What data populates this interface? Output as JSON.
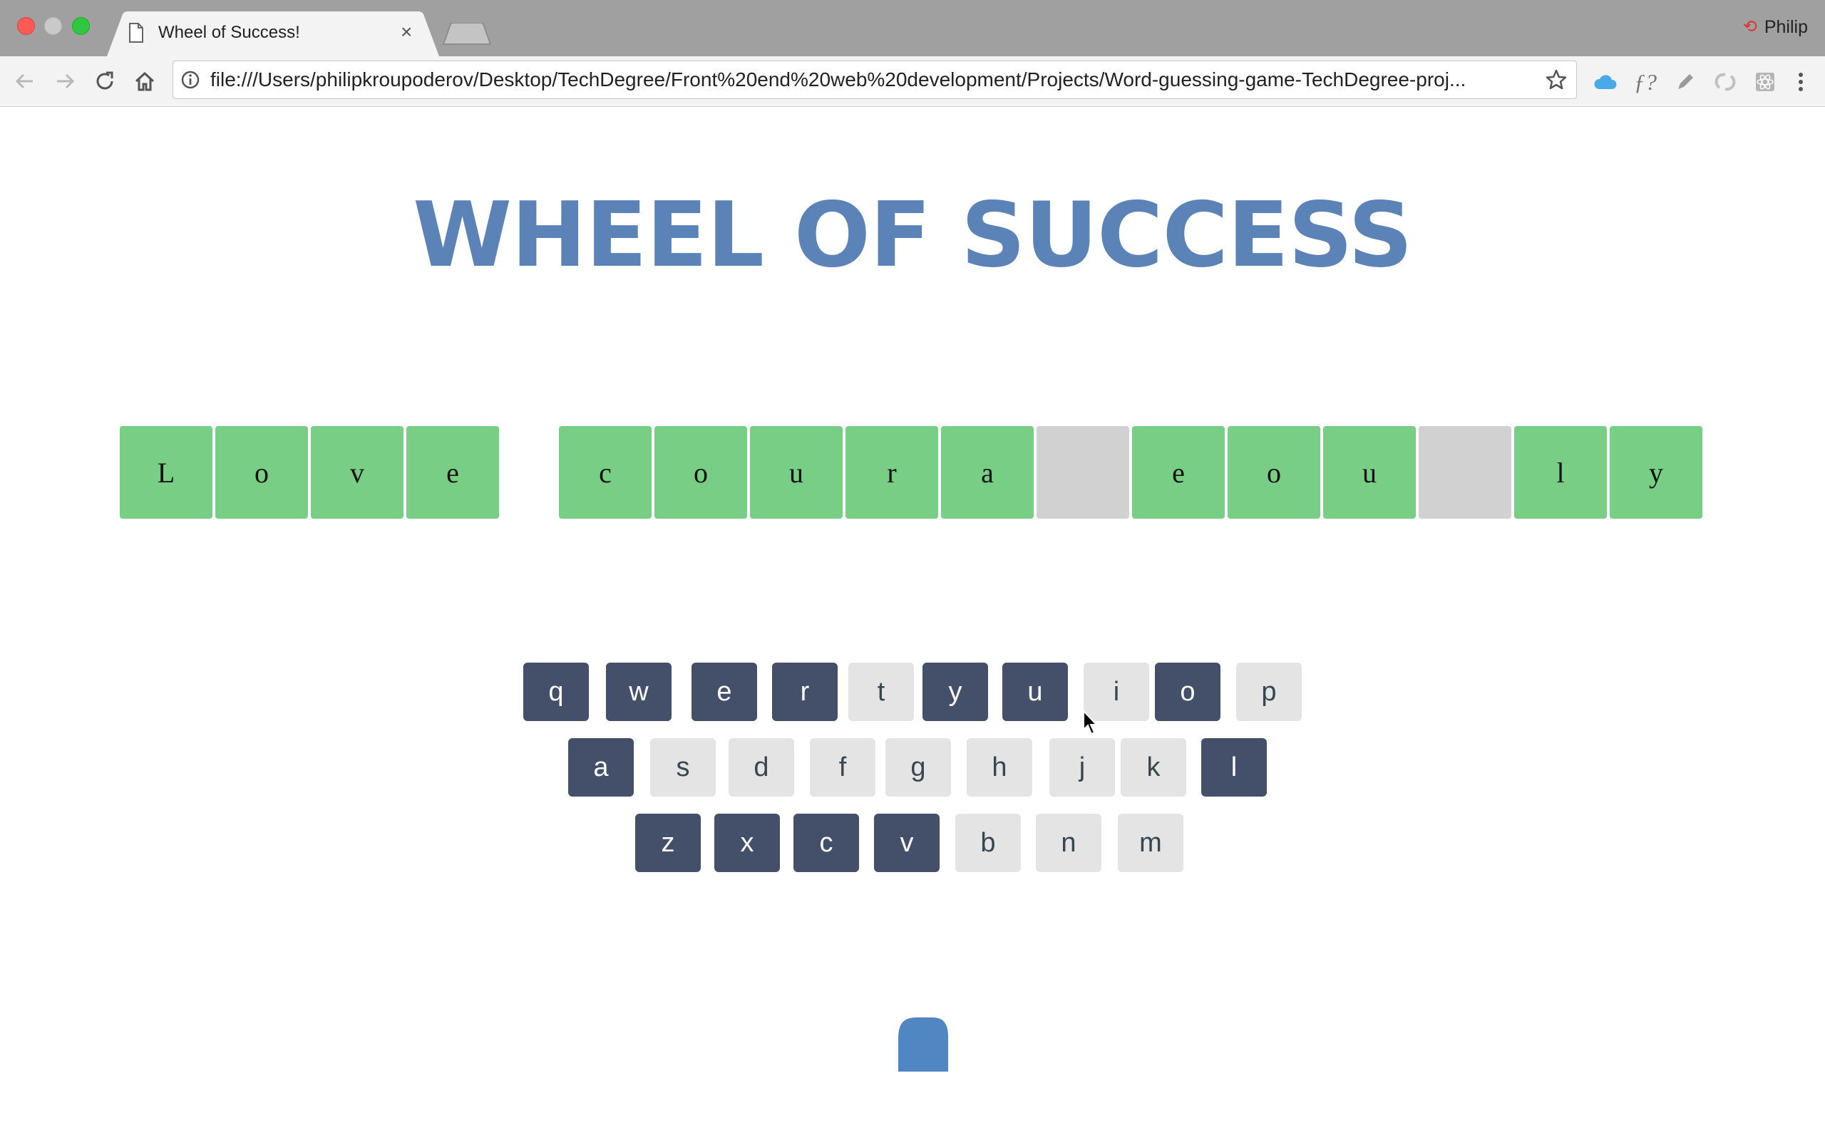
{
  "browser": {
    "tab_title": "Wheel of Success!",
    "tab_close": "×",
    "url": "file:///Users/philipkroupoderov/Desktop/TechDegree/Front%20end%20web%20development/Projects/Word-guessing-game-TechDegree-proj...",
    "profile_name": "Philip",
    "icons": [
      "back-icon",
      "forward-icon",
      "reload-icon",
      "home-icon",
      "info-icon",
      "star-icon",
      "cloud-extension-icon",
      "font-extension-icon",
      "pen-extension-icon",
      "sync-extension-icon",
      "react-extension-icon",
      "menu-icon"
    ]
  },
  "game": {
    "title": "WHEEL OF SUCCESS",
    "phrase": [
      {
        "letter": "L",
        "shown": true
      },
      {
        "letter": "o",
        "shown": true
      },
      {
        "letter": "v",
        "shown": true
      },
      {
        "letter": "e",
        "shown": true
      },
      {
        "letter": "c",
        "shown": true
      },
      {
        "letter": "o",
        "shown": true
      },
      {
        "letter": "u",
        "shown": true
      },
      {
        "letter": "r",
        "shown": true
      },
      {
        "letter": "a",
        "shown": true
      },
      {
        "letter": "",
        "shown": false
      },
      {
        "letter": "e",
        "shown": true
      },
      {
        "letter": "o",
        "shown": true
      },
      {
        "letter": "u",
        "shown": true
      },
      {
        "letter": "",
        "shown": false
      },
      {
        "letter": "l",
        "shown": true
      },
      {
        "letter": "y",
        "shown": true
      }
    ],
    "keyboard": {
      "row1": [
        {
          "key": "q",
          "chosen": true
        },
        {
          "key": "w",
          "chosen": true
        },
        {
          "key": "e",
          "chosen": true
        },
        {
          "key": "r",
          "chosen": true
        },
        {
          "key": "t",
          "chosen": false
        },
        {
          "key": "y",
          "chosen": true
        },
        {
          "key": "u",
          "chosen": true
        },
        {
          "key": "i",
          "chosen": false
        },
        {
          "key": "o",
          "chosen": true
        },
        {
          "key": "p",
          "chosen": false
        }
      ],
      "row2": [
        {
          "key": "a",
          "chosen": true
        },
        {
          "key": "s",
          "chosen": false
        },
        {
          "key": "d",
          "chosen": false
        },
        {
          "key": "f",
          "chosen": false
        },
        {
          "key": "g",
          "chosen": false
        },
        {
          "key": "h",
          "chosen": false
        },
        {
          "key": "j",
          "chosen": false
        },
        {
          "key": "k",
          "chosen": false
        },
        {
          "key": "l",
          "chosen": true
        }
      ],
      "row3": [
        {
          "key": "z",
          "chosen": true
        },
        {
          "key": "x",
          "chosen": true
        },
        {
          "key": "c",
          "chosen": true
        },
        {
          "key": "v",
          "chosen": true
        },
        {
          "key": "b",
          "chosen": false
        },
        {
          "key": "n",
          "chosen": false
        },
        {
          "key": "m",
          "chosen": false
        }
      ]
    },
    "lives_shown": 1,
    "colors": {
      "title": "#5b83b7",
      "shown_tile": "#78ce84",
      "hidden_tile": "#d1d1d1",
      "chosen_key": "#445069",
      "free_key": "#e4e4e4",
      "heart": "#5086c1"
    }
  }
}
